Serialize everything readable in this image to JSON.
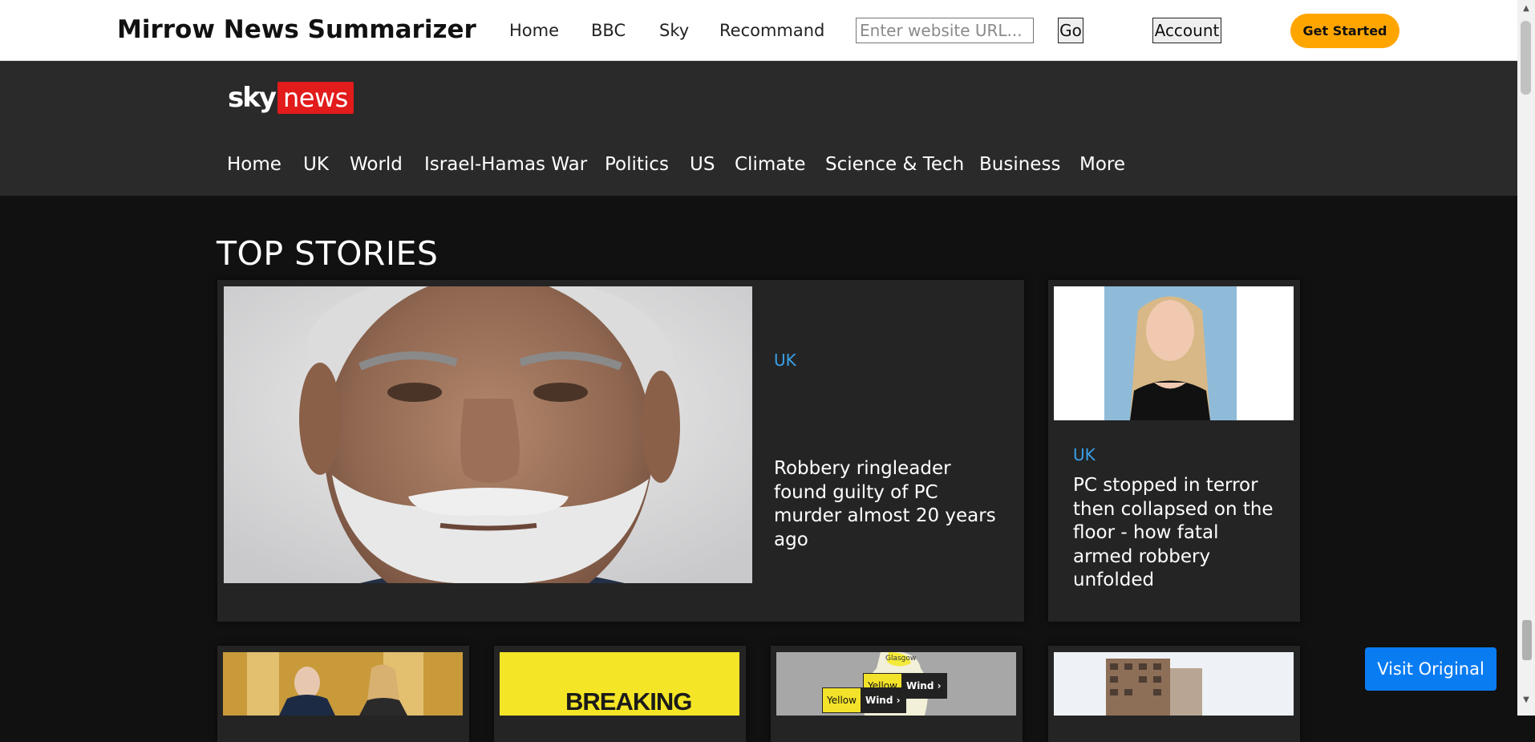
{
  "app": {
    "title": "Mirrow News Summarizer",
    "nav": [
      "Home",
      "BBC",
      "Sky",
      "Recommand"
    ],
    "url_placeholder": "Enter website URL...",
    "go_label": "Go",
    "account_label": "Account",
    "get_started_label": "Get Started",
    "accent_color": "#ffa500"
  },
  "sky": {
    "logo_sky": "sky",
    "logo_news": "news",
    "nav": [
      "Home",
      "UK",
      "World",
      "Israel-Hamas War",
      "Politics",
      "US",
      "Climate",
      "Science & Tech",
      "Business",
      "More"
    ],
    "brand_red": "#e21b1b"
  },
  "main": {
    "section_title": "TOP STORIES",
    "featured": {
      "category": "UK",
      "headline": "Robbery ringleader found guilty of PC murder almost 20 years ago"
    },
    "side_story": {
      "category": "UK",
      "headline": "PC stopped in terror then collapsed on the floor - how fatal armed robbery unfolded"
    },
    "thumbnails": {
      "breaking_text": "BREAKING",
      "map_place": "Glasgow",
      "warning_1_level": "Yellow",
      "warning_1_type": "Wind",
      "warning_2_level": "Yellow",
      "warning_2_type": "Wind"
    },
    "category_color": "#3aa0e8"
  },
  "floating": {
    "visit_original_label": "Visit Original"
  }
}
